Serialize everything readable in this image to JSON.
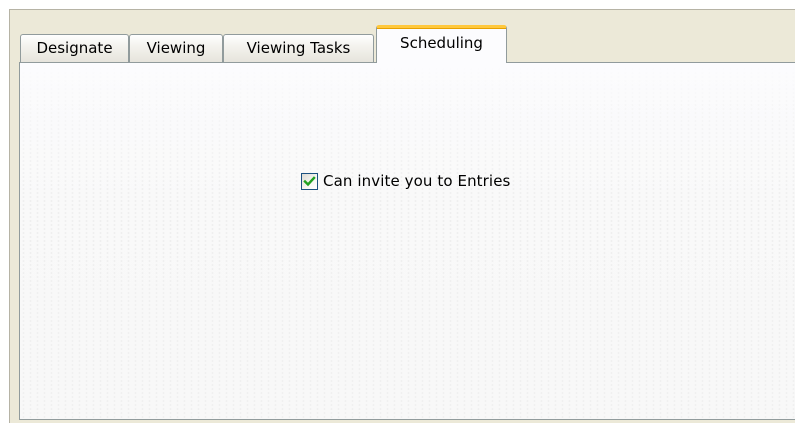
{
  "tabs": [
    {
      "label": "Designate",
      "active": false
    },
    {
      "label": "Viewing",
      "active": false
    },
    {
      "label": "Viewing Tasks",
      "active": false
    },
    {
      "label": "Scheduling",
      "active": true
    }
  ],
  "scheduling": {
    "invite_checkbox": {
      "label": "Can invite you to Entries",
      "checked": true
    }
  },
  "colors": {
    "active_tab_accent": "#ffc83c",
    "checkmark": "#21a121",
    "tab_border": "#919b9c",
    "frame_background": "#ece9d8"
  },
  "icons": {
    "checkbox": "checkmark-icon"
  }
}
